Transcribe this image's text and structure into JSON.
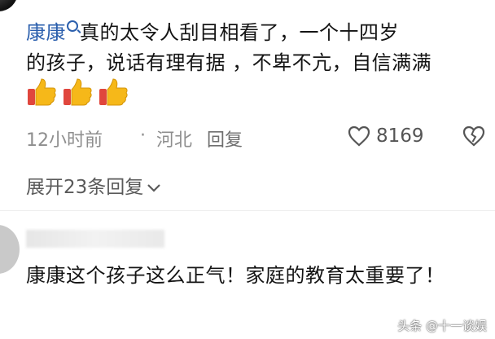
{
  "comment1": {
    "username": "康康",
    "body_line1": "真的太令人刮目相看了，一个十四岁",
    "body_rest": "的孩子，说话有理有据 ，不卑不亢，自信满满",
    "emoji": [
      "thumbs-up",
      "thumbs-up",
      "thumbs-up"
    ],
    "time": "12小时前",
    "dot": "·",
    "location": "河北",
    "reply_label": "回复",
    "like_count": "8169",
    "expand_label": "展开23条回复"
  },
  "comment2": {
    "body": "康康这个孩子这么正气！家庭的教育太重要了！"
  },
  "watermark": "头条 @十一谈娱",
  "colors": {
    "username": "#2b5fad",
    "meta": "#8e8e8e",
    "emoji_yellow": "#f6b819",
    "emoji_red": "#e0463d"
  }
}
